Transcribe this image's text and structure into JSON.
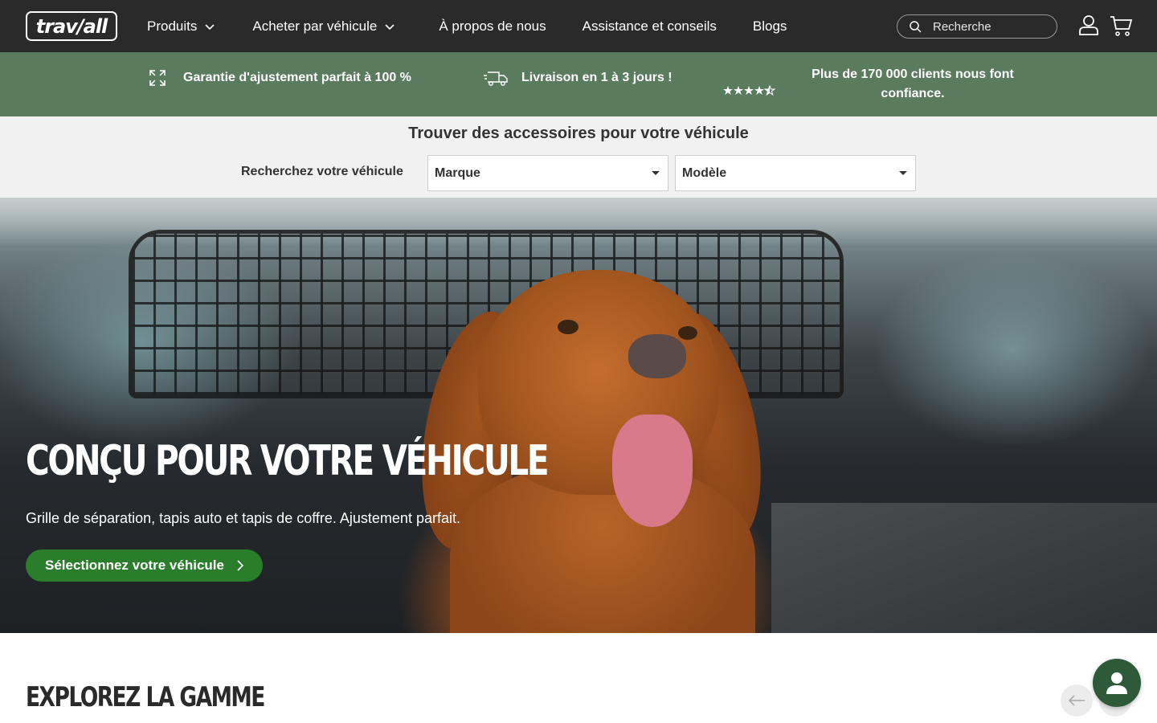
{
  "header": {
    "logo_text": "trav/all",
    "nav": [
      {
        "label": "Produits",
        "has_dropdown": true
      },
      {
        "label": "Acheter par véhicule",
        "has_dropdown": true
      },
      {
        "label": "À propos de nous",
        "has_dropdown": false
      },
      {
        "label": "Assistance et conseils",
        "has_dropdown": false
      },
      {
        "label": "Blogs",
        "has_dropdown": false
      }
    ],
    "search_placeholder": "Recherche"
  },
  "usp": [
    {
      "icon": "expand-arrows-icon",
      "text": "Garantie d'ajustement parfait à 100 %"
    },
    {
      "icon": "delivery-truck-icon",
      "text": "Livraison en 1 à 3 jours !"
    },
    {
      "icon": "star-rating-icon",
      "rating_stars": 4.5,
      "text": "Plus de 170 000 clients nous font confiance."
    }
  ],
  "finder": {
    "title": "Trouver des accessoires pour votre véhicule",
    "label": "Recherchez votre véhicule",
    "make_select": "Marque",
    "model_select": "Modèle"
  },
  "hero": {
    "title": "CONÇU POUR VOTRE VÉHICULE",
    "subtitle": "Grille de séparation, tapis auto et tapis de coffre. Ajustement parfait.",
    "cta": "Sélectionnez votre véhicule"
  },
  "section": {
    "title": "EXPLOREZ LA GAMME"
  },
  "colors": {
    "header_bg": "#2a2a2a",
    "usp_bg": "#5b7b5e",
    "cta_green": "#2a7d2a",
    "chat_bg": "#2f5a3a"
  }
}
